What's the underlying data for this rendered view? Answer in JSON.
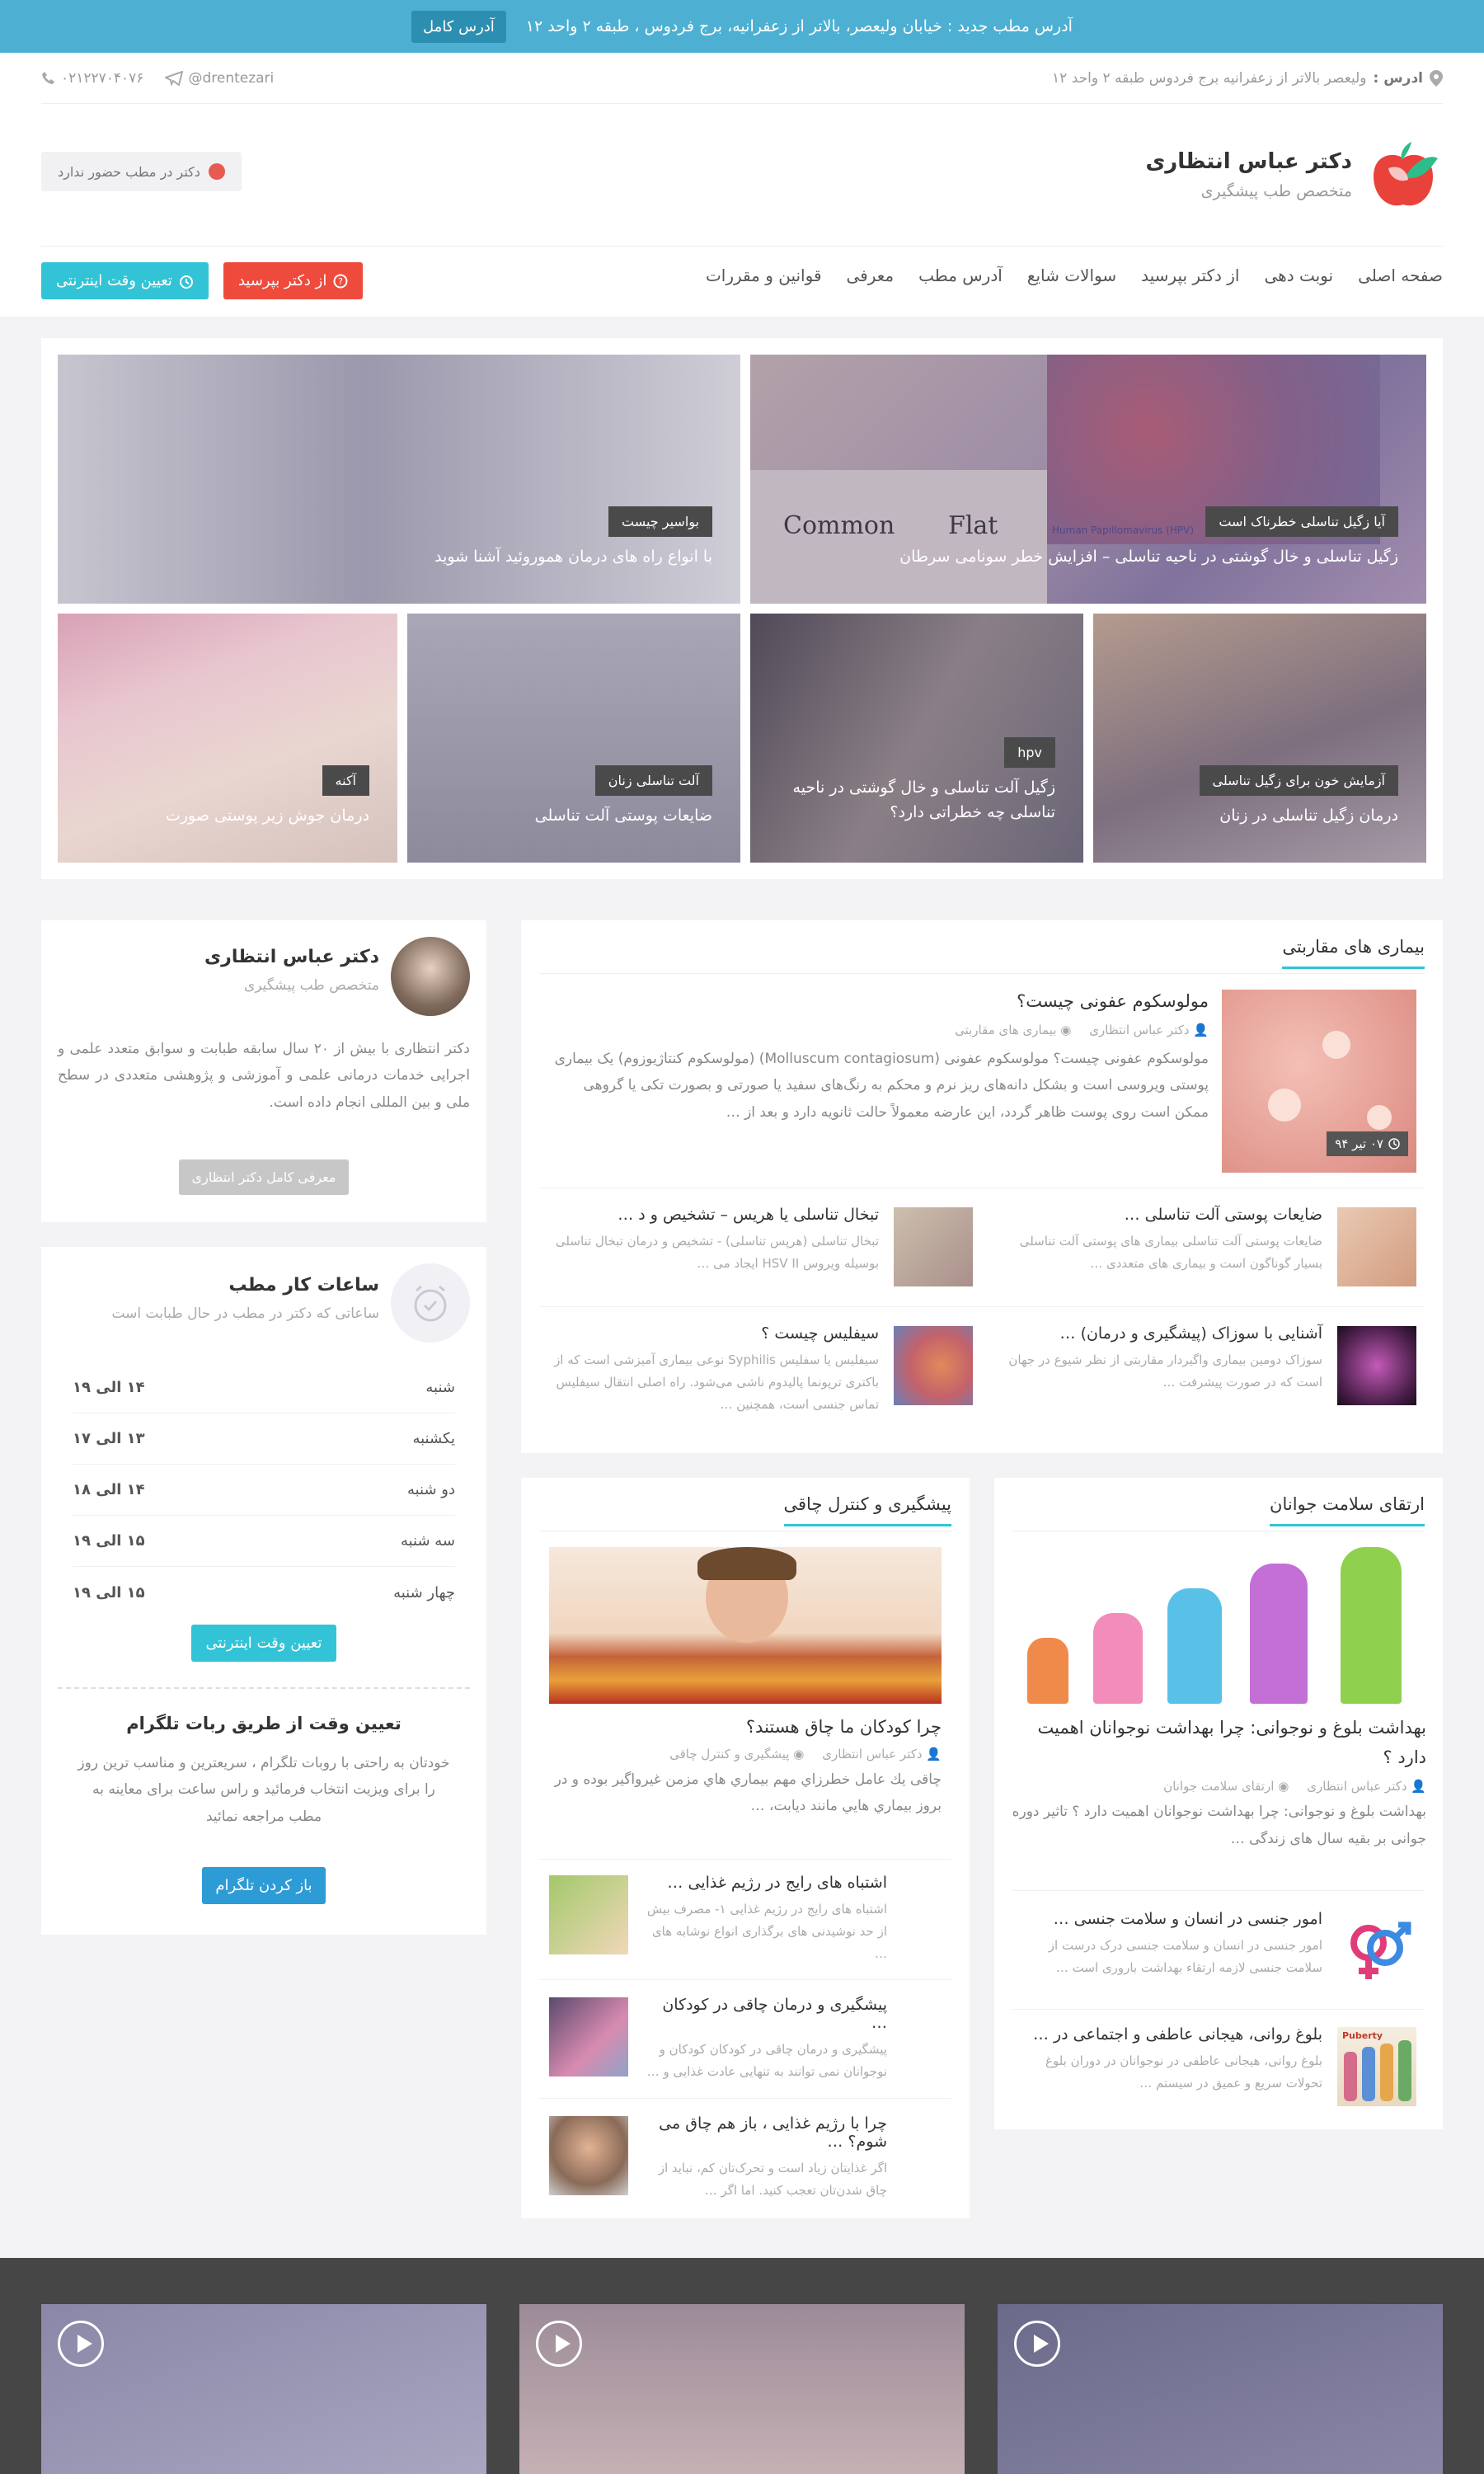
{
  "topbar": {
    "message": "آدرس مطب جدید : خیابان ولیعصر، بالاتر از زعفرانیه، برج فردوس ، طبقه ۲ واحد ۱۲",
    "button": "آدرس کامل"
  },
  "info": {
    "address_label": "ادرس :",
    "address": "ولیعصر بالاتر از زعفرانیه برج فردوس طبقه ۲ واحد ۱۲",
    "telegram": "@drentezari",
    "phone": "۰۲۱۲۲۷۰۴۰۷۶"
  },
  "brand": {
    "name": "دکتر عباس انتظاری",
    "subtitle": "متخصص طب پیشگیری"
  },
  "presence": "دکتر در مطب حضور ندارد",
  "nav": [
    "صفحه اصلی",
    "نوبت دهی",
    "از دکتر بپرسید",
    "سوالات شایع",
    "آدرس مطب",
    "معرفی",
    "قوانین و مقررات"
  ],
  "nav_buttons": {
    "appointment": "تعیین وقت اینترنتی",
    "ask": "از دکتر بپرسید"
  },
  "hero": [
    {
      "tag": "آیا زگیل تناسلی خطرناک است",
      "caption": "زگیل تناسلی و خال گوشتی در ناحیه تناسلی – افزایش خطر سونامی سرطان",
      "image_labels": [
        "Common",
        "Flat",
        "Human Papillomavirus (HPV)"
      ]
    },
    {
      "tag": "بواسیر چیست",
      "caption": "با انواع راه های درمان هموروئید آشنا شوید"
    },
    {
      "tag": "آزمایش خون برای زگیل تناسلی",
      "caption": "درمان زگیل تناسلی در زنان"
    },
    {
      "tag": "hpv",
      "caption": "زگیل آلت تناسلی و خال گوشتی در ناحیه تناسلی چه خطراتی دارد؟"
    },
    {
      "tag": "آلت تناسلی زنان",
      "caption": "ضایعات پوستی آلت تناسلی"
    },
    {
      "tag": "آکنه",
      "caption": "درمان جوش زیر پوستی صورت"
    }
  ],
  "std": {
    "title": "بیماری های مقاربتی",
    "featured": {
      "title": "مولوسکوم عفونی چیست؟",
      "author": "دکتر عباس انتظاری",
      "category": "بیماری های مقاربتی",
      "excerpt": "مولوسکوم عفونی چیست؟ مولوسکوم عفونی (Molluscum contagiosum) (مولوسکوم کنتاژیوزوم) یک بیماری پوستی ویروسی است و بشکل دانه‌های ریز نرم و محکم به رنگ‌های سفید یا صورتی و بصورت تکی یا گروهی ممکن است روی پوست ظاهر گردد، این عارضه معمولاً حالت ثانویه دارد و بعد از …",
      "date": "۰۷ تیر ۹۴"
    },
    "items": [
      {
        "title": "ضایعات پوستی آلت تناسلی …",
        "excerpt": "ضایعات پوستی آلت تناسلی بیماری های پوستی آلت تناسلی بسیار گوناگون است و بیماری های متعددی …"
      },
      {
        "title": "تبخال تناسلی یا هریس – تشخیص و د …",
        "excerpt": "تبخال تناسلی (هرپس تناسلی) - تشخیص و درمان تبخال تناسلی بوسیله ویروس HSV II ایجاد می …"
      },
      {
        "title": "آشنایی با سوزاک (پیشگیری و درمان) …",
        "excerpt": "سوزاک دومین بیماری واگیردار مقاربتی از نظر شیوع در جهان است که در صورت پیشرفت …"
      },
      {
        "title": "سیفلیس چیست ؟",
        "excerpt": "سیفلیس یا سفلیس Syphilis نوعی بیماری آمیزشی است که از باکتری ترپونما پالیدوم ناشی می‌شود. راه اصلی انتقال سیفلیس تماس جنسی است، همچنین …"
      }
    ]
  },
  "profile": {
    "name": "دکتر عباس انتظاری",
    "subtitle": "متخصص طب پیشگیری",
    "bio": "دکتر انتظاری با بیش از ۲۰ سال سابقه طبابت و سوابق متعدد علمی و اجرایی خدمات درمانی علمی و آموزشی و پژوهشی متعددی در سطح ملی و بین المللی انجام داده است.",
    "button": "معرفی کامل دکتر انتظاری"
  },
  "hours": {
    "title": "ساعات کار مطب",
    "subtitle": "ساعاتی که دکتر در مطب در حال طبابت است",
    "days": [
      {
        "day": "شنبه",
        "time": "۱۴ الی ۱۹"
      },
      {
        "day": "یکشنبه",
        "time": "۱۳ الی ۱۷"
      },
      {
        "day": "دو شنبه",
        "time": "۱۴ الی ۱۸"
      },
      {
        "day": "سه شنبه",
        "time": "۱۵ الی ۱۹"
      },
      {
        "day": "چهار شنبه",
        "time": "۱۵ الی ۱۹"
      }
    ],
    "button": "تعیین وقت اینترنتی",
    "telegram_title": "تعیین وقت از طریق ربات تلگرام",
    "telegram_text": "خودتان به راحتی با روبات تلگرام ، سریعترین و مناسب ترین روز را برای ویزیت انتخاب فرمائید و راس ساعت برای معاینه به مطب مراجعه نمائید",
    "telegram_button": "باز کردن تلگرام"
  },
  "youth": {
    "title": "ارتقای سلامت جوانان",
    "featured": {
      "title": "بهداشت بلوغ و نوجوانی: چرا بهداشت نوجوانان اهمیت دارد ؟",
      "author": "دکتر عباس انتظاری",
      "category": "ارتقای سلامت جوانان",
      "excerpt": "بهداشت بلوغ و نوجوانی: چرا بهداشت نوجوانان اهمیت دارد ؟ تاثیر دوره جوانی بر بقیه سال های زندگی …"
    },
    "items": [
      {
        "title": "امور جنسی در انسان و سلامت جنسی …",
        "excerpt": "امور جنسی در انسان و سلامت جنسی درک درست از سلامت جنسی  لازمه ارتقاء بهداشت باروری است …"
      },
      {
        "title": "بلوغ روانی، هیجانی عاطفی و اجتماعی در …",
        "excerpt": "بلوغ روانی، هیجانی عاطفی در نوجوانان     در دوران بلوغ تحولات سریع و عمیق در سیستم …",
        "thumb_label": "Puberty"
      }
    ]
  },
  "obesity": {
    "title": "پیشگیری و کنترل چاقی",
    "featured": {
      "title": "چرا کودکان ما چاق هستند؟",
      "author": "دکتر عباس انتظاری",
      "category": "پیشگیری و کنترل چاقی",
      "excerpt": "چاقی يك عامل خطرزاي مهم بيماري هاي مزمن غيرواگير بوده و در بروز بيماري هايي مانند ديابت، …"
    },
    "items": [
      {
        "title": "اشتباه های رایج در رژیم غذایی …",
        "excerpt": "اشتباه های رایج در رژیم غذایی ۱- مصرف بیش از حد نوشیدنی های برگذاری انواع نوشابه های …"
      },
      {
        "title": "پیشگیری و درمان چاقی در کودکان …",
        "excerpt": "پیشگیری و درمان چاقی در کودکان کودکان و نوجوانان نمی توانند به تنهایی عادت غذایی و …"
      },
      {
        "title": "چرا با رژیم غذایی ، باز هم چاق می شوم؟ …",
        "excerpt": "اگر غذایتان زیاد است و تحرک‌تان کم، نباید از چاق شدن‌تان تعجب کنید. اما اگر …"
      }
    ]
  },
  "colors": {
    "accent": "#32c4d6",
    "topbar": "#4db0d3",
    "danger": "#ee4b3c",
    "footer": "#464646"
  },
  "icons": [
    "location-icon",
    "telegram-icon",
    "phone-icon",
    "clock-icon",
    "question-icon",
    "user-icon",
    "folder-icon",
    "play-icon"
  ]
}
